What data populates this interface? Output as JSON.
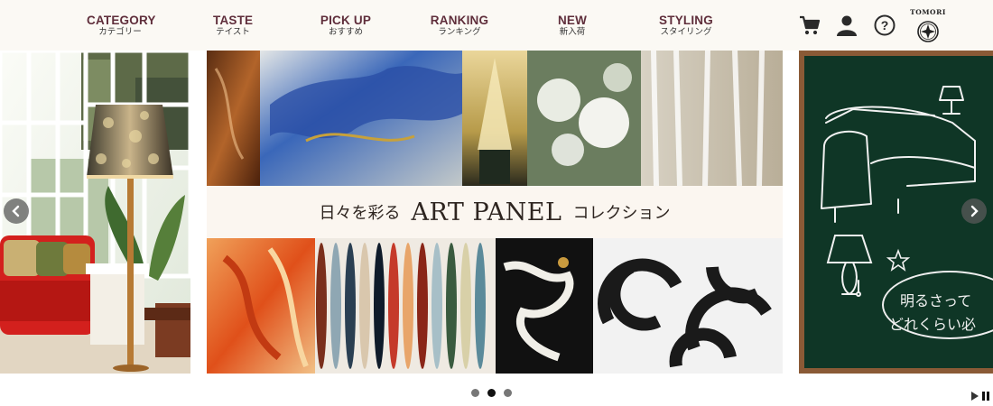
{
  "nav": [
    {
      "en": "CATEGORY",
      "ja": "カテゴリー"
    },
    {
      "en": "TASTE",
      "ja": "テイスト"
    },
    {
      "en": "PICK UP",
      "ja": "おすすめ"
    },
    {
      "en": "RANKING",
      "ja": "ランキング"
    },
    {
      "en": "NEW",
      "ja": "新入荷"
    },
    {
      "en": "STYLING",
      "ja": "スタイリング"
    }
  ],
  "header_icons": [
    "cart-icon",
    "user-icon",
    "help-icon",
    "tomori-logo"
  ],
  "logo": {
    "text": "TOMORI"
  },
  "banner": {
    "pre": "日々を彩る",
    "main": "ART PANEL",
    "post": "コレクション"
  },
  "chalkboard": {
    "line1": "明るさって",
    "line2": "どれくらい必"
  },
  "slider": {
    "dot_count": 3,
    "active_dot": 2
  },
  "colors": {
    "nav_text": "#5f2e3b",
    "header_bg": "#fbf9f4",
    "chalkboard": "#0f3626",
    "sofa_red": "#d3201d"
  }
}
